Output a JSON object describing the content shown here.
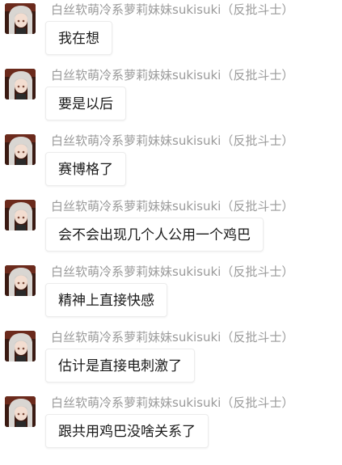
{
  "messages": [
    {
      "sender": "白丝软萌冷系萝莉妹妹sukisuki（反批斗士）",
      "text": "我在想",
      "avatar_icon": "anime-girl-avatar-icon"
    },
    {
      "sender": "白丝软萌冷系萝莉妹妹sukisuki（反批斗士）",
      "text": "要是以后",
      "avatar_icon": "anime-girl-avatar-icon"
    },
    {
      "sender": "白丝软萌冷系萝莉妹妹sukisuki（反批斗士）",
      "text": "赛博格了",
      "avatar_icon": "anime-girl-avatar-icon"
    },
    {
      "sender": "白丝软萌冷系萝莉妹妹sukisuki（反批斗士）",
      "text": "会不会出现几个人公用一个鸡巴",
      "avatar_icon": "anime-girl-avatar-icon"
    },
    {
      "sender": "白丝软萌冷系萝莉妹妹sukisuki（反批斗士）",
      "text": "精神上直接快感",
      "avatar_icon": "anime-girl-avatar-icon"
    },
    {
      "sender": "白丝软萌冷系萝莉妹妹sukisuki（反批斗士）",
      "text": "估计是直接电刺激了",
      "avatar_icon": "anime-girl-avatar-icon"
    },
    {
      "sender": "白丝软萌冷系萝莉妹妹sukisuki（反批斗士）",
      "text": "跟共用鸡巴没啥关系了",
      "avatar_icon": "anime-girl-avatar-icon"
    }
  ],
  "colors": {
    "sender_name": "#9a9a9a",
    "message_text": "#1a1a1a",
    "bubble_border": "#ececec",
    "avatar_background": "#3a1a12",
    "avatar_hair": "#d9d6d2"
  }
}
